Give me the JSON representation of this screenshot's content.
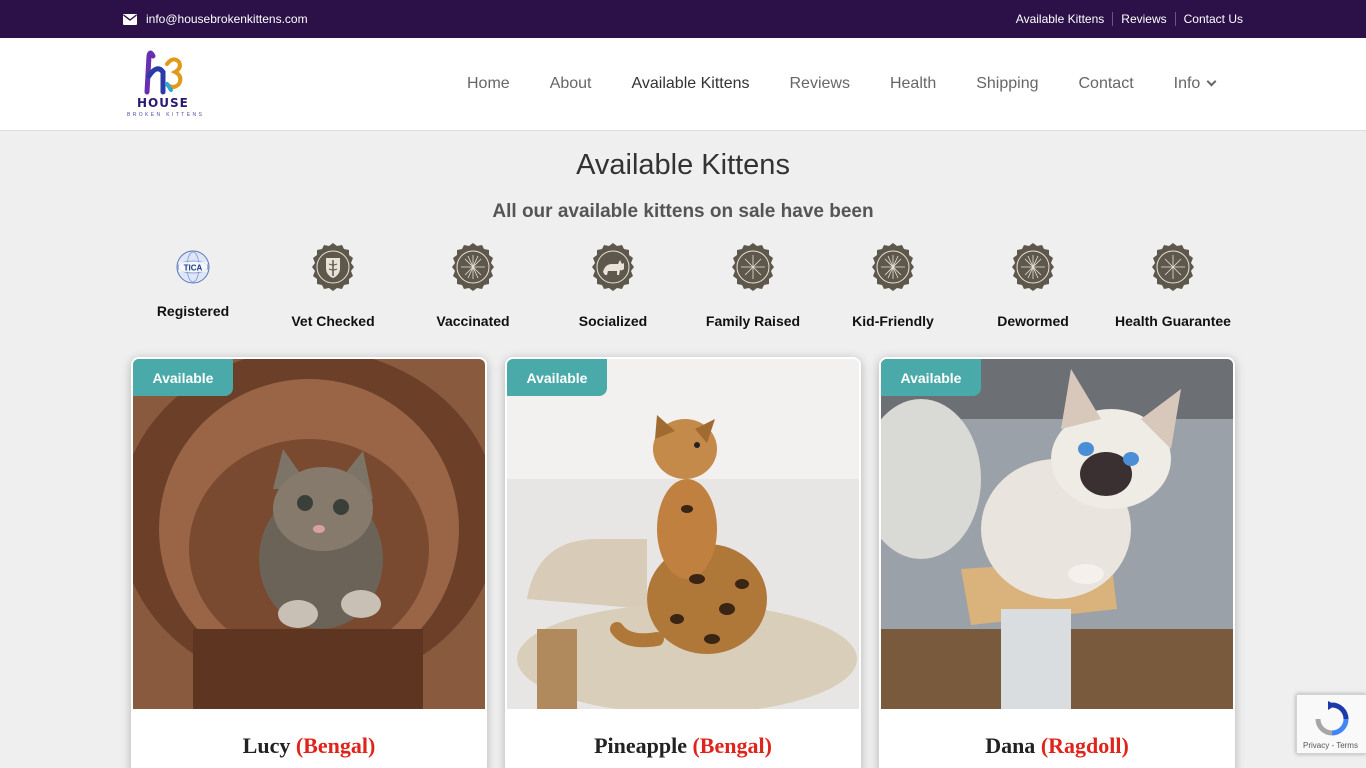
{
  "topbar": {
    "email": "info@housebrokenkittens.com",
    "links": [
      "Available Kittens",
      "Reviews",
      "Contact Us"
    ]
  },
  "logo": {
    "brand": "HOUSE",
    "sub": "BROKEN KITTENS"
  },
  "nav": {
    "items": [
      "Home",
      "About",
      "Available Kittens",
      "Reviews",
      "Health",
      "Shipping",
      "Contact",
      "Info"
    ],
    "active": "Available Kittens"
  },
  "page": {
    "title": "Available Kittens",
    "subtitle": "All our available kittens on sale have been"
  },
  "badges": [
    {
      "label": "Registered",
      "icon": "tica-logo"
    },
    {
      "label": "Vet Checked",
      "icon": "caduceus-shield-icon"
    },
    {
      "label": "Vaccinated",
      "icon": "sunburst-seal-icon"
    },
    {
      "label": "Socialized",
      "icon": "cat-seal-icon"
    },
    {
      "label": "Family Raised",
      "icon": "sunburst-seal-icon"
    },
    {
      "label": "Kid-Friendly",
      "icon": "sunburst-seal-icon"
    },
    {
      "label": "Dewormed",
      "icon": "sunburst-seal-icon"
    },
    {
      "label": "Health Guarantee",
      "icon": "sunburst-seal-icon"
    }
  ],
  "kittens": [
    {
      "status": "Available",
      "name": "Lucy",
      "breed": "(Bengal)"
    },
    {
      "status": "Available",
      "name": "Pineapple",
      "breed": "(Bengal)"
    },
    {
      "status": "Available",
      "name": "Dana",
      "breed": "(Ragdoll)"
    }
  ],
  "recaptcha": {
    "terms": "Privacy - Terms"
  },
  "colors": {
    "topbar": "#2b1148",
    "status_tag": "#4aa9a9",
    "breed_text": "#e0241b",
    "seal": "#5e584c"
  }
}
